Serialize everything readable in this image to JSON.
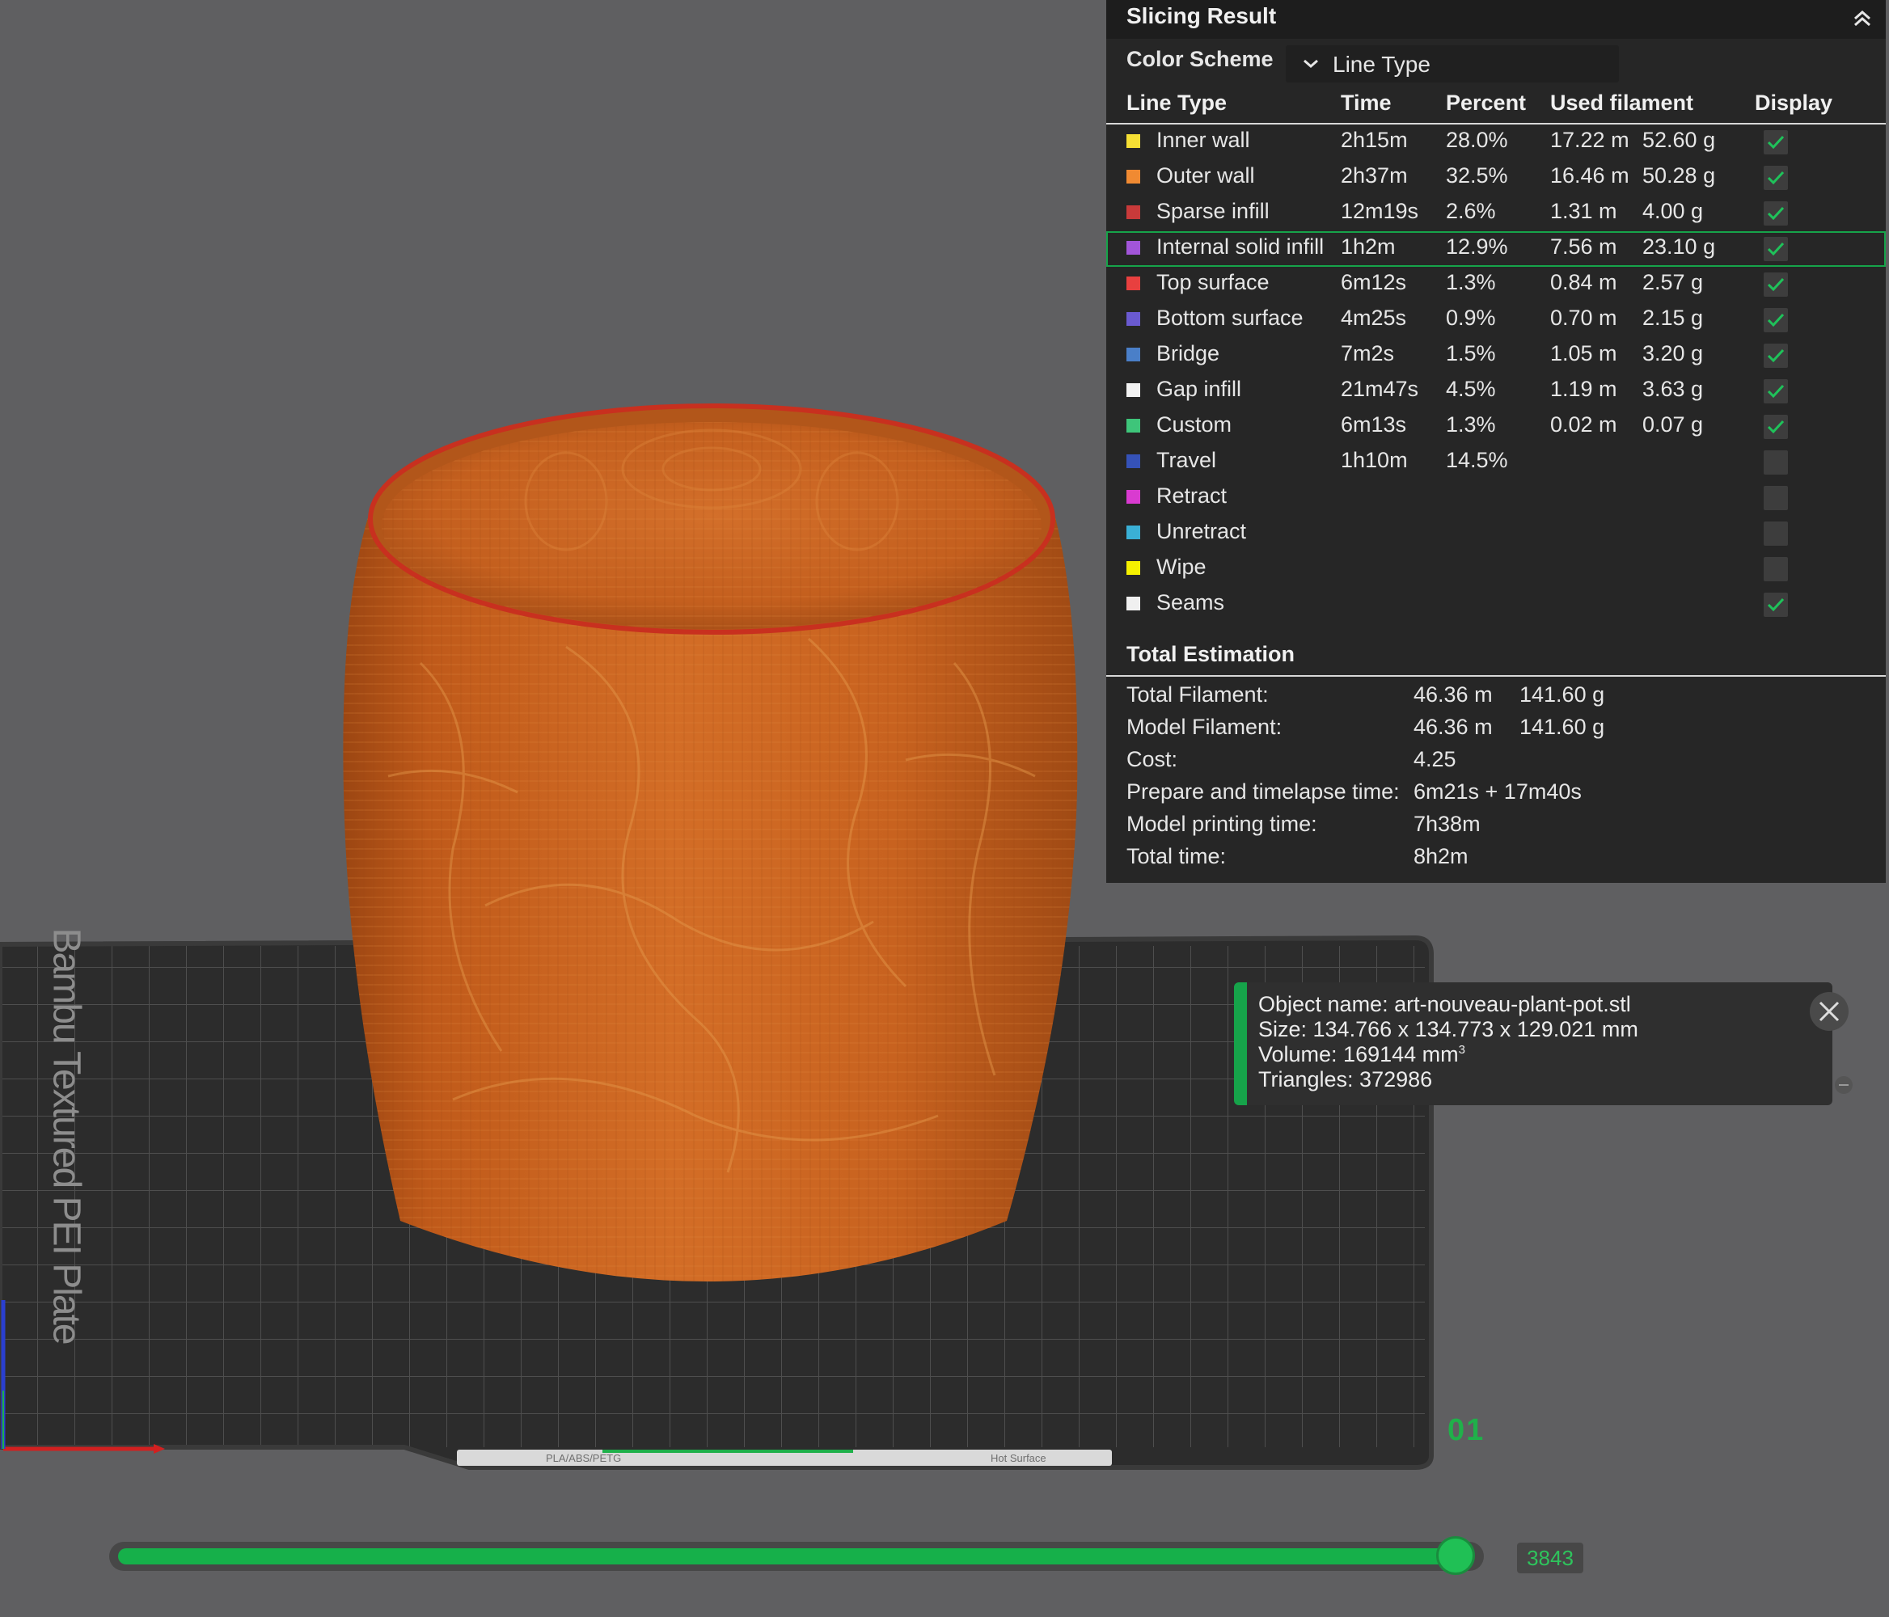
{
  "viewport": {
    "plate_name": "Bambu Textured PEI Plate",
    "plate_number": "01",
    "strip_text_left": "PLA/ABS/PETG",
    "strip_text_right": "Hot Surface"
  },
  "slicing_result": {
    "title": "Slicing Result",
    "collapse_icon": "chevron-up-double-icon",
    "color_scheme_label": "Color Scheme",
    "color_scheme_value": "Line Type",
    "columns": {
      "line_type": "Line Type",
      "time": "Time",
      "percent": "Percent",
      "used_filament": "Used filament",
      "display": "Display"
    },
    "rows": [
      {
        "name": "Inner wall",
        "color": "#f5df34",
        "time": "2h15m",
        "percent": "28.0%",
        "length": "17.22 m",
        "weight": "52.60 g",
        "display": true
      },
      {
        "name": "Outer wall",
        "color": "#f08a32",
        "time": "2h37m",
        "percent": "32.5%",
        "length": "16.46 m",
        "weight": "50.28 g",
        "display": true
      },
      {
        "name": "Sparse infill",
        "color": "#c83a3a",
        "time": "12m19s",
        "percent": "2.6%",
        "length": "1.31 m",
        "weight": "4.00 g",
        "display": true
      },
      {
        "name": "Internal solid infill",
        "color": "#a255d9",
        "time": "1h2m",
        "percent": "12.9%",
        "length": "7.56 m",
        "weight": "23.10 g",
        "display": true,
        "selected": true
      },
      {
        "name": "Top surface",
        "color": "#e8403f",
        "time": "6m12s",
        "percent": "1.3%",
        "length": "0.84 m",
        "weight": "2.57 g",
        "display": true
      },
      {
        "name": "Bottom surface",
        "color": "#6a5ad0",
        "time": "4m25s",
        "percent": "0.9%",
        "length": "0.70 m",
        "weight": "2.15 g",
        "display": true
      },
      {
        "name": "Bridge",
        "color": "#4a7fc8",
        "time": "7m2s",
        "percent": "1.5%",
        "length": "1.05 m",
        "weight": "3.20 g",
        "display": true
      },
      {
        "name": "Gap infill",
        "color": "#f2f2f2",
        "time": "21m47s",
        "percent": "4.5%",
        "length": "1.19 m",
        "weight": "3.63 g",
        "display": true
      },
      {
        "name": "Custom",
        "color": "#3ec57a",
        "time": "6m13s",
        "percent": "1.3%",
        "length": "0.02 m",
        "weight": "0.07 g",
        "display": true
      },
      {
        "name": "Travel",
        "color": "#3552b8",
        "time": "1h10m",
        "percent": "14.5%",
        "length": "",
        "weight": "",
        "display": false
      },
      {
        "name": "Retract",
        "color": "#d93bd0",
        "time": "",
        "percent": "",
        "length": "",
        "weight": "",
        "display": false
      },
      {
        "name": "Unretract",
        "color": "#3ab0d6",
        "time": "",
        "percent": "",
        "length": "",
        "weight": "",
        "display": false
      },
      {
        "name": "Wipe",
        "color": "#f5f000",
        "time": "",
        "percent": "",
        "length": "",
        "weight": "",
        "display": false
      },
      {
        "name": "Seams",
        "color": "#f0f0f0",
        "time": "",
        "percent": "",
        "length": "",
        "weight": "",
        "display": true
      }
    ],
    "total_estimation": {
      "title": "Total Estimation",
      "rows": [
        {
          "label": "Total Filament:",
          "v1": "46.36 m",
          "v2": "141.60 g"
        },
        {
          "label": "Model Filament:",
          "v1": "46.36 m",
          "v2": "141.60 g"
        },
        {
          "label": "Cost:",
          "v1": "4.25",
          "v2": ""
        },
        {
          "label": "Prepare and timelapse time:",
          "v1": "6m21s + 17m40s",
          "v2": ""
        },
        {
          "label": "Model printing time:",
          "v1": "7h38m",
          "v2": ""
        },
        {
          "label": "Total time:",
          "v1": "8h2m",
          "v2": ""
        }
      ]
    }
  },
  "object_info": {
    "name_line": "Object name: art-nouveau-plant-pot.stl",
    "size_line": "Size: 134.766 x 134.773 x 129.021 mm",
    "volume_line": "Volume: 169144 mm",
    "volume_unit_sup": "3",
    "triangles_line": "Triangles: 372986",
    "close_icon": "close-icon"
  },
  "layer_slider": {
    "value": "3843",
    "fill_fraction": 1.0
  },
  "colors": {
    "accent": "#16a34a",
    "model": "#c8621f",
    "background": "#5f5f61",
    "panel": "#262626"
  }
}
